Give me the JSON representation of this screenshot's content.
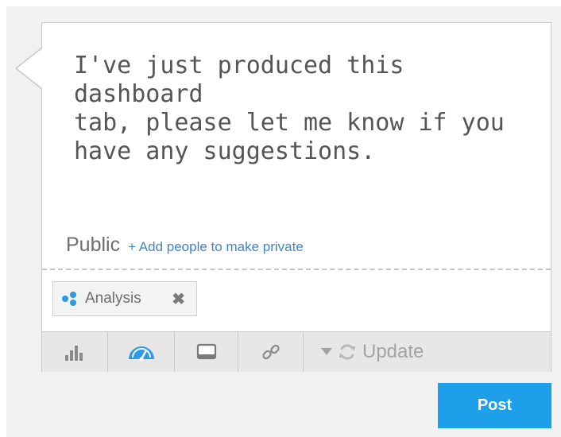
{
  "composer": {
    "message": "I've just produced this dashboard\ntab, please let me know if you\nhave any suggestions.",
    "visibility_label": "Public",
    "add_people_link": "+ Add people to make private"
  },
  "tags": [
    {
      "label": "Analysis",
      "icon": "analysis-dots-icon",
      "remove_icon": "close-icon"
    }
  ],
  "toolbar": {
    "buttons": [
      {
        "icon": "bar-chart-icon"
      },
      {
        "icon": "gauge-icon"
      },
      {
        "icon": "screen-icon"
      },
      {
        "icon": "link-icon"
      }
    ],
    "update_label": "Update",
    "update_icons": [
      "caret-down-icon",
      "refresh-icon"
    ]
  },
  "actions": {
    "post_label": "Post"
  },
  "colors": {
    "accent": "#1e9fea",
    "link": "#3f86c6",
    "tag_icon": "#2e9ae6"
  }
}
